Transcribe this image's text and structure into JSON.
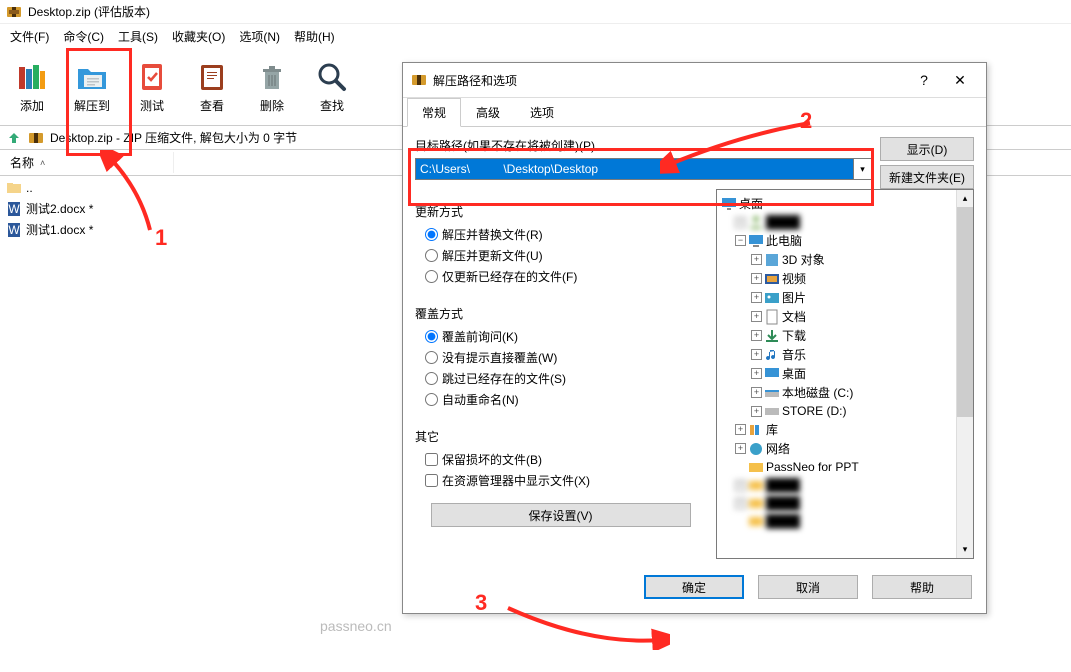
{
  "titlebar": {
    "title": "Desktop.zip (评估版本)"
  },
  "menu": {
    "file": "文件(F)",
    "cmd": "命令(C)",
    "tools": "工具(S)",
    "fav": "收藏夹(O)",
    "opt": "选项(N)",
    "help": "帮助(H)"
  },
  "toolbar": {
    "add": "添加",
    "extract_to": "解压到",
    "test": "测试",
    "view": "查看",
    "delete": "删除",
    "find": "查找"
  },
  "pathbar": {
    "text": "Desktop.zip - ZIP 压缩文件, 解包大小为 0 字节"
  },
  "listheader": {
    "name": "名称"
  },
  "files": {
    "up": "..",
    "f1": "测试2.docx *",
    "f2": "测试1.docx *"
  },
  "dialog": {
    "title": "解压路径和选项",
    "tabs": {
      "general": "常规",
      "advanced": "高级",
      "options": "选项"
    },
    "pathlabel": "目标路径(如果不存在将被创建)(P)",
    "pathvalue": "C:\\Users\\          \\Desktop\\Desktop",
    "show_btn": "显示(D)",
    "newfolder_btn": "新建文件夹(E)",
    "group_update": "更新方式",
    "upd1": "解压并替换文件(R)",
    "upd2": "解压并更新文件(U)",
    "upd3": "仅更新已经存在的文件(F)",
    "group_overwrite": "覆盖方式",
    "ov1": "覆盖前询问(K)",
    "ov2": "没有提示直接覆盖(W)",
    "ov3": "跳过已经存在的文件(S)",
    "ov4": "自动重命名(N)",
    "group_other": "其它",
    "ot1": "保留损坏的文件(B)",
    "ot2": "在资源管理器中显示文件(X)",
    "save_btn": "保存设置(V)",
    "ok": "确定",
    "cancel": "取消",
    "help": "帮助"
  },
  "tree": {
    "desktop": "桌面",
    "thispc": "此电脑",
    "obj3d": "3D 对象",
    "video": "视频",
    "pictures": "图片",
    "docs": "文档",
    "downloads": "下载",
    "music": "音乐",
    "desktop2": "桌面",
    "diskC": "本地磁盘 (C:)",
    "diskD": "STORE (D:)",
    "lib": "库",
    "network": "网络",
    "passneo": "PassNeo for PPT"
  },
  "annotations": {
    "l1": "1",
    "l2": "2",
    "l3": "3"
  },
  "watermark": "passneo.cn"
}
